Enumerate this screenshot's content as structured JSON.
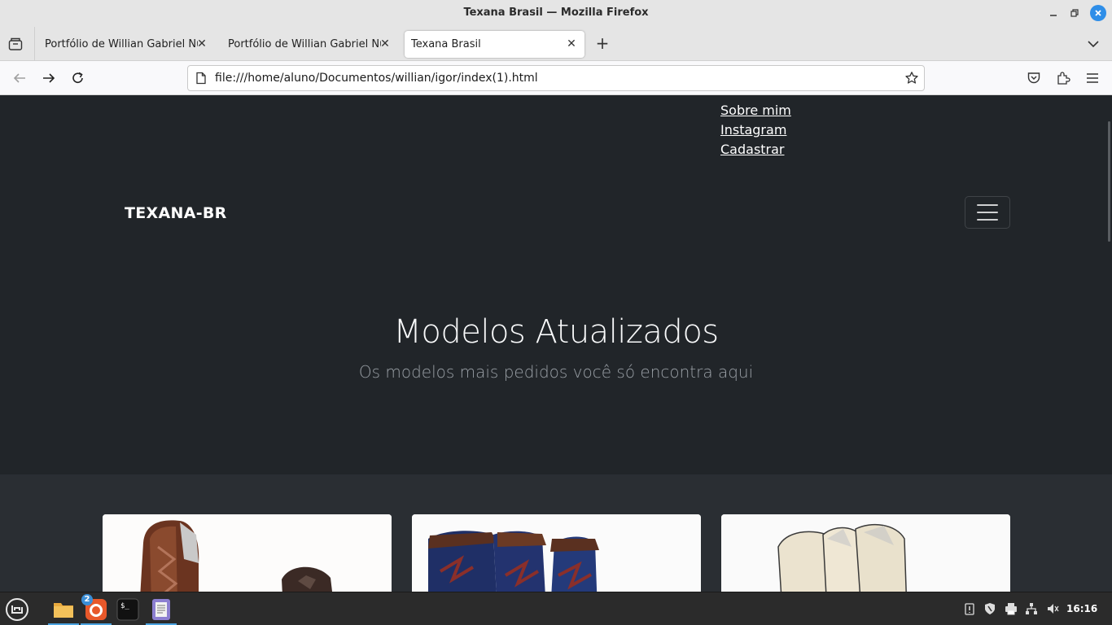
{
  "window": {
    "title": "Texana Brasil — Mozilla Firefox"
  },
  "tabs": [
    {
      "label": "Portfólio de Willian Gabriel Nunes"
    },
    {
      "label": "Portfólio de Willian Gabriel Nunes"
    },
    {
      "label": "Texana Brasil"
    }
  ],
  "urlbar": {
    "url": "file:///home/aluno/Documentos/willian/igor/index(1).html"
  },
  "page": {
    "top_links": [
      "Sobre mim",
      "Instagram",
      "Cadastrar"
    ],
    "brand": "TEXANA-BR",
    "hero_title": "Modelos Atualizados",
    "hero_subtitle": "Os modelos mais pedidos você só encontra aqui"
  },
  "taskbar": {
    "firefox_badge": "2",
    "clock": "16:16"
  },
  "colors": {
    "page_bg": "#212529",
    "products_bg": "#2a2e33",
    "accent": "#2e8ee8"
  }
}
